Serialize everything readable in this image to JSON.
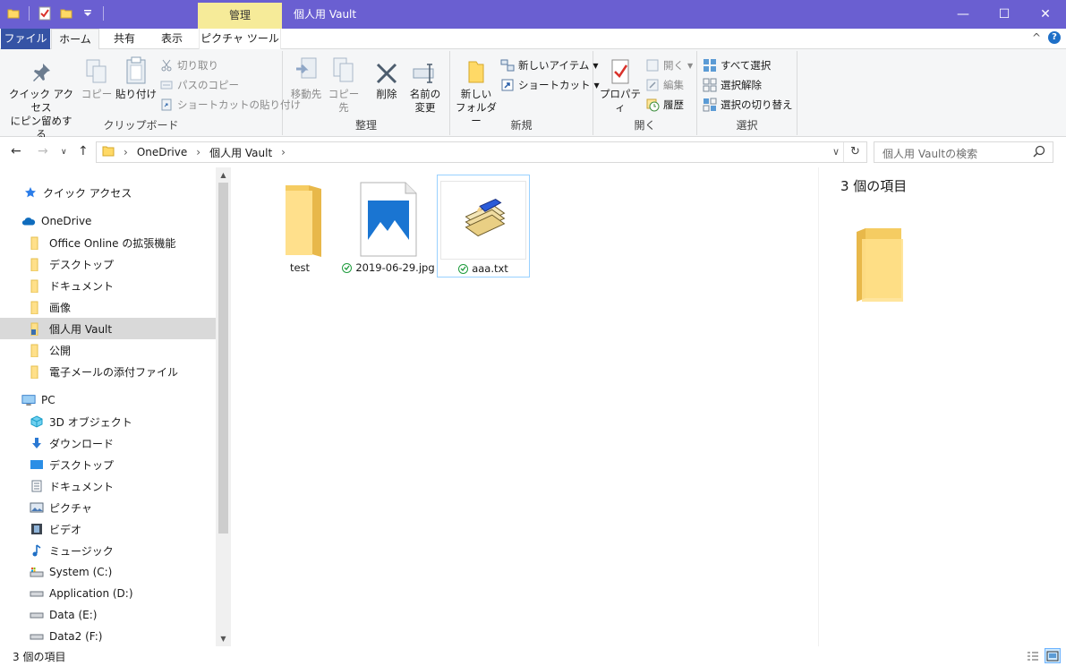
{
  "window": {
    "title": "個人用 Vault",
    "manage_tab": "管理",
    "controls": {
      "minimize": "—",
      "maximize": "☐",
      "close": "✕"
    }
  },
  "ribbon_tabs": {
    "file": "ファイル",
    "home": "ホーム",
    "share": "共有",
    "view": "表示",
    "picture_tools": "ピクチャ ツール",
    "collapse": "^",
    "help": "?"
  },
  "ribbon": {
    "clipboard": {
      "label": "クリップボード",
      "pin": [
        "クイック アクセス",
        "にピン留めする"
      ],
      "copy": "コピー",
      "paste": "貼り付け",
      "cut": "切り取り",
      "copy_path": "パスのコピー",
      "paste_shortcut": "ショートカットの貼り付け"
    },
    "organize": {
      "label": "整理",
      "move_to": "移動先",
      "copy_to": "コピー先",
      "delete": "削除",
      "rename": [
        "名前の",
        "変更"
      ]
    },
    "new": {
      "label": "新規",
      "new_folder": [
        "新しい",
        "フォルダー"
      ],
      "new_item": "新しいアイテム",
      "shortcut": "ショートカット"
    },
    "open": {
      "label": "開く",
      "properties": "プロパティ",
      "open": "開く",
      "edit": "編集",
      "history": "履歴"
    },
    "select": {
      "label": "選択",
      "select_all": "すべて選択",
      "select_none": "選択解除",
      "invert": "選択の切り替え"
    }
  },
  "address": {
    "crumbs": [
      "OneDrive",
      "個人用 Vault"
    ],
    "search_placeholder": "個人用 Vaultの検索"
  },
  "nav": {
    "quick_access": "クイック アクセス",
    "onedrive": "OneDrive",
    "onedrive_items": [
      "Office Online の拡張機能",
      "デスクトップ",
      "ドキュメント",
      "画像",
      "個人用 Vault",
      "公開",
      "電子メールの添付ファイル"
    ],
    "pc": "PC",
    "pc_items": [
      "3D オブジェクト",
      "ダウンロード",
      "デスクトップ",
      "ドキュメント",
      "ピクチャ",
      "ビデオ",
      "ミュージック",
      "System (C:)",
      "Application (D:)",
      "Data (E:)",
      "Data2 (F:)"
    ]
  },
  "files": [
    {
      "name": "test",
      "type": "folder"
    },
    {
      "name": "2019-06-29.jpg",
      "type": "image"
    },
    {
      "name": "aaa.txt",
      "type": "text"
    }
  ],
  "details": {
    "count": "3 個の項目"
  },
  "status": {
    "count": "3 個の項目"
  },
  "colors": {
    "titlebar": "#6a5fd1",
    "file_tab": "#3553a5",
    "manage_tab": "#f6eb99",
    "selection": "#d9d9d9"
  }
}
